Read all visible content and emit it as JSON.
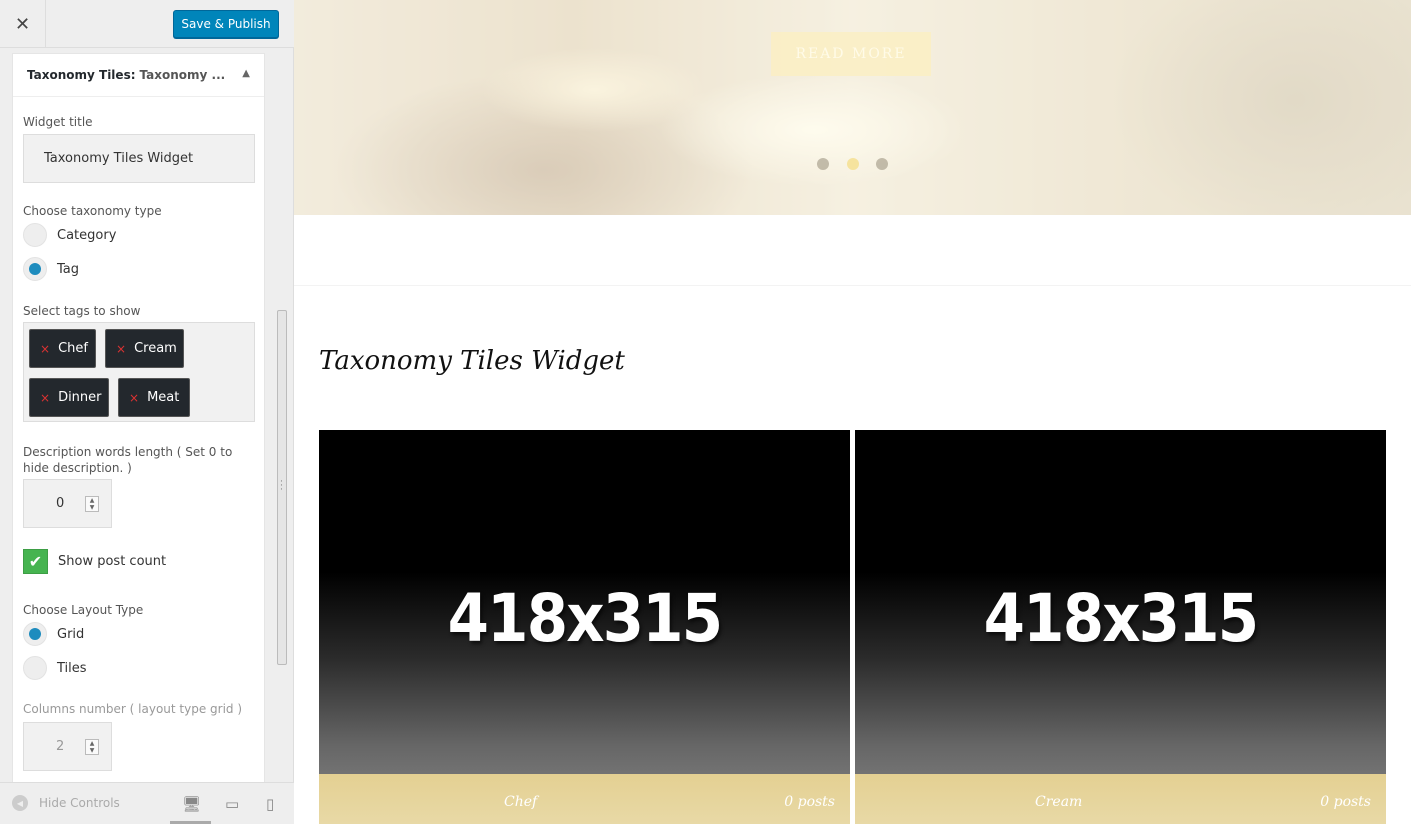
{
  "topbar": {
    "close_label": "✕",
    "publish_label": "Save & Publish"
  },
  "widget": {
    "header_prefix": "Taxonomy Tiles:",
    "header_sub": "Taxonomy ...",
    "title_label": "Widget title",
    "title_value": "Taxonomy Tiles Widget",
    "taxonomy_label": "Choose taxonomy type",
    "taxonomy_options": [
      {
        "label": "Category",
        "selected": false
      },
      {
        "label": "Tag",
        "selected": true
      }
    ],
    "tags_label": "Select tags to show",
    "tags": [
      "Chef",
      "Cream",
      "Dinner",
      "Meat"
    ],
    "desc_label": "Description words length ( Set 0 to hide description. )",
    "desc_value": "0",
    "post_count_label": "Show post count",
    "post_count_checked": true,
    "layout_label": "Choose Layout Type",
    "layout_options": [
      {
        "label": "Grid",
        "selected": true
      },
      {
        "label": "Tiles",
        "selected": false
      }
    ],
    "columns_label": "Columns number ( layout type grid )",
    "columns_value": "2"
  },
  "footer": {
    "hide_controls_label": "Hide Controls",
    "devices": [
      "desktop-icon",
      "tablet-icon",
      "mobile-icon"
    ]
  },
  "preview": {
    "read_more_label": "READ MORE",
    "slider_dots": 3,
    "active_dot": 1,
    "section_title": "Taxonomy Tiles Widget",
    "tiles": [
      {
        "placeholder": "418x315",
        "name": "Chef",
        "count": "0 posts"
      },
      {
        "placeholder": "418x315",
        "name": "Cream",
        "count": "0 posts"
      }
    ]
  },
  "colors": {
    "publish": "#0085ba",
    "radio_on": "#1e8cbe",
    "checkbox": "#46b450",
    "tile_caption": "#e4d092"
  }
}
